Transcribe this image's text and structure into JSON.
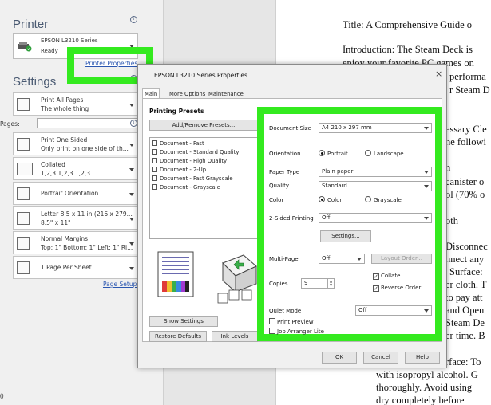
{
  "left_panel": {
    "printer_title": "Printer",
    "printer_name": "EPSON L3210 Series",
    "printer_status": "Ready",
    "printer_properties_link": "Printer Properties",
    "settings_title": "Settings",
    "rows": [
      {
        "l1": "Print All Pages",
        "l2": "The whole thing"
      },
      {
        "l1": "Print One Sided",
        "l2": "Only print on one side of th..."
      },
      {
        "l1": "Collated",
        "l2": "1,2,3   1,2,3   1,2,3"
      },
      {
        "l1": "Portrait Orientation",
        "l2": ""
      },
      {
        "l1": "Letter 8.5 x 11 in (216 x 279...",
        "l2": "8.5\" x 11\""
      },
      {
        "l1": "Normal Margins",
        "l2": "Top: 1\" Bottom: 1\" Left: 1\" Ri..."
      },
      {
        "l1": "1 Page Per Sheet",
        "l2": ""
      }
    ],
    "pages_label": "Pages:",
    "page_setup_link": "Page Setup",
    "bottom_char": "0"
  },
  "document": {
    "lines": [
      "Title: A Comprehensive Guide o",
      "Introduction: The Steam Deck is",
      "enjoy your favorite PC games on",
      "performa",
      "r Steam D",
      "essary Cle",
      "he followi",
      "h",
      "canister o",
      "ol (70% o",
      "oth",
      "Disconnec",
      "nnect any",
      "Surface:",
      "er cloth. T",
      "to pay att",
      "and Open",
      "Steam De",
      "er time. B",
      "rface: To",
      "with isopropyl alcohol. G",
      "thoroughly. Avoid using",
      "dry completely before"
    ]
  },
  "dialog": {
    "title": "EPSON L3210 Series Properties",
    "close_glyph": "×",
    "tabs": [
      "Main",
      "More Options",
      "Maintenance"
    ],
    "presets_heading": "Printing Presets",
    "add_remove_label": "Add/Remove Presets...",
    "presets": [
      "Document - Fast",
      "Document - Standard Quality",
      "Document - High Quality",
      "Document - 2-Up",
      "Document - Fast Grayscale",
      "Document - Grayscale"
    ],
    "show_settings_label": "Show Settings",
    "restore_defaults_label": "Restore Defaults",
    "ink_levels_label": "Ink Levels",
    "settings": {
      "document_size_label": "Document Size",
      "document_size_value": "A4 210 x 297 mm",
      "orientation_label": "Orientation",
      "orientation_options": [
        "Portrait",
        "Landscape"
      ],
      "orientation_selected": "Portrait",
      "paper_type_label": "Paper Type",
      "paper_type_value": "Plain paper",
      "quality_label": "Quality",
      "quality_value": "Standard",
      "color_label": "Color",
      "color_options": [
        "Color",
        "Grayscale"
      ],
      "color_selected": "Color",
      "two_sided_label": "2-Sided Printing",
      "two_sided_value": "Off",
      "settings_button_label": "Settings...",
      "multi_page_label": "Multi-Page",
      "multi_page_value": "Off",
      "layout_order_label": "Layout Order...",
      "copies_label": "Copies",
      "copies_value": "9",
      "collate_label": "Collate",
      "collate_checked": true,
      "reverse_order_label": "Reverse Order",
      "reverse_order_checked": true,
      "quiet_mode_label": "Quiet Mode",
      "quiet_mode_value": "Off",
      "print_preview_label": "Print Preview",
      "print_preview_checked": false,
      "job_arranger_label": "Job Arranger Lite",
      "job_arranger_checked": false
    },
    "ok_label": "OK",
    "cancel_label": "Cancel",
    "help_label": "Help"
  },
  "colors": {
    "highlight_green": "#34ea1f",
    "link_blue": "#2a56b0",
    "panel_grey": "#f0f0f0"
  },
  "icons": [
    "info-icon",
    "printer-icon",
    "ready-check-icon",
    "pages-icon",
    "one-sided-icon",
    "collated-icon",
    "orientation-icon",
    "paper-size-icon",
    "margins-icon",
    "pages-per-sheet-icon",
    "preset-document-icon",
    "paper-preview-icon",
    "printer-tray-icon",
    "close-icon",
    "chevron-down-icon",
    "spin-arrows-icon"
  ]
}
